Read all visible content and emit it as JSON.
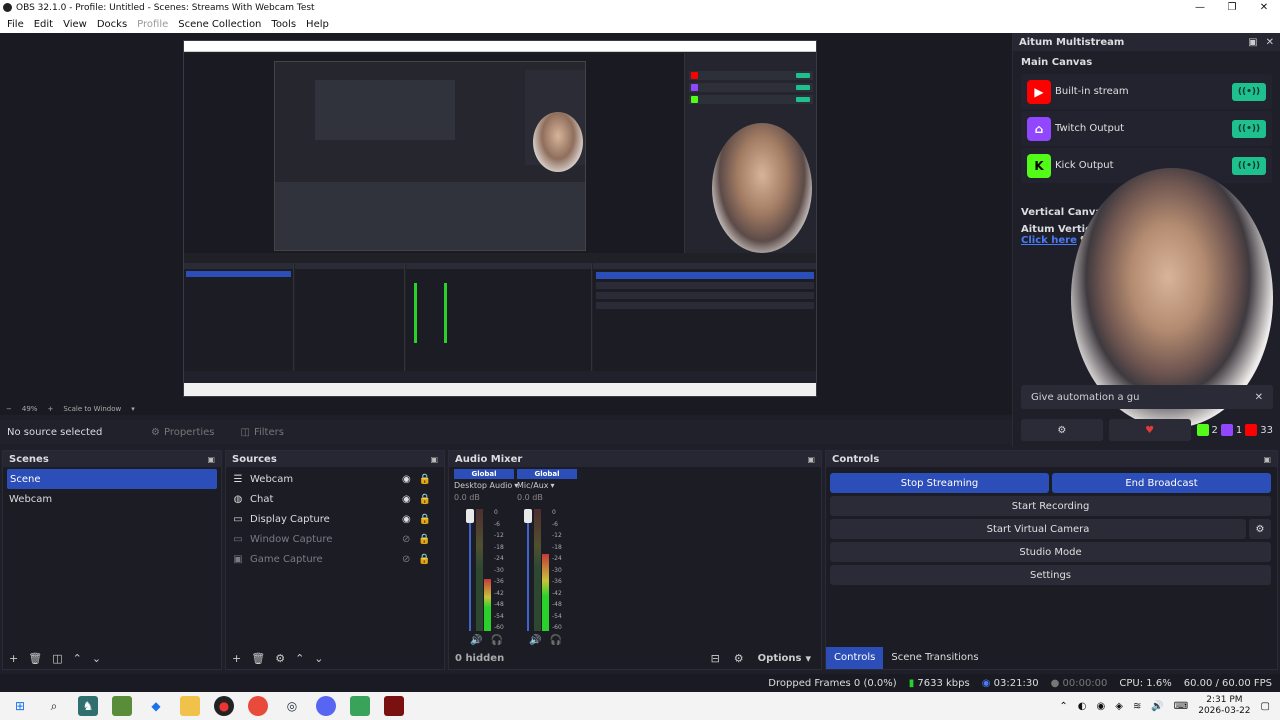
{
  "window": {
    "title": "OBS 32.1.0 - Profile: Untitled - Scenes: Streams With Webcam Test",
    "controls": [
      "—",
      "❐",
      "✕"
    ]
  },
  "menu": [
    {
      "label": "File",
      "enabled": true
    },
    {
      "label": "Edit",
      "enabled": true
    },
    {
      "label": "View",
      "enabled": true
    },
    {
      "label": "Docks",
      "enabled": true
    },
    {
      "label": "Profile",
      "enabled": false
    },
    {
      "label": "Scene Collection",
      "enabled": true
    },
    {
      "label": "Tools",
      "enabled": true
    },
    {
      "label": "Help",
      "enabled": true
    }
  ],
  "preview": {
    "zoom": "49%",
    "zoom_mode": "Scale to Window"
  },
  "source_toolbar": {
    "no_source": "No source selected",
    "properties": "Properties",
    "filters": "Filters"
  },
  "multistream": {
    "title": "Aitum Multistream",
    "main_canvas": "Main Canvas",
    "outputs": [
      {
        "name": "Built-in stream",
        "logo": "youtube-icon",
        "color": "#ff0000"
      },
      {
        "name": "Twitch Output",
        "logo": "twitch-icon",
        "color": "#9146ff"
      },
      {
        "name": "Kick Output",
        "logo": "kick-icon",
        "color": "#53fc18"
      }
    ],
    "toggle_glyph": "((•))",
    "vertical_canvas": "Vertical Canvas",
    "vertical_text": "Aitum Vertical i",
    "click_here": "Click here",
    "click_here_suffix": " to d",
    "automation_text": "Give automation a gu",
    "automation_close": "✕",
    "stats": {
      "kick": "2",
      "twitch": "1",
      "youtube": "33"
    }
  },
  "scenes": {
    "title": "Scenes",
    "items": [
      "Scene",
      "Webcam"
    ],
    "selected": 0
  },
  "sources": {
    "title": "Sources",
    "items": [
      {
        "name": "Webcam",
        "icon": "list-icon",
        "glyph": "☰",
        "visible": true
      },
      {
        "name": "Chat",
        "icon": "globe-icon",
        "glyph": "◍",
        "visible": true
      },
      {
        "name": "Display Capture",
        "icon": "monitor-icon",
        "glyph": "▭",
        "visible": true
      },
      {
        "name": "Window Capture",
        "icon": "window-icon",
        "glyph": "▭",
        "visible": false
      },
      {
        "name": "Game Capture",
        "icon": "gamepad-icon",
        "glyph": "▣",
        "visible": false
      }
    ]
  },
  "mixer": {
    "title": "Audio Mixer",
    "channels": [
      {
        "global": "Global",
        "name": "Desktop Audio",
        "db": "0.0 dB"
      },
      {
        "global": "Global",
        "name": "Mic/Aux",
        "db": "0.0 dB"
      }
    ],
    "ticks": [
      "0",
      "-6",
      "-12",
      "-18",
      "-24",
      "-30",
      "-36",
      "-42",
      "-48",
      "-54",
      "-60"
    ],
    "hidden": "0 hidden",
    "options": "Options"
  },
  "controls": {
    "title": "Controls",
    "stop_streaming": "Stop Streaming",
    "end_broadcast": "End Broadcast",
    "start_recording": "Start Recording",
    "start_virtual_camera": "Start Virtual Camera",
    "studio_mode": "Studio Mode",
    "settings": "Settings",
    "tab_controls": "Controls",
    "tab_scene_transitions": "Scene Transitions"
  },
  "status": {
    "dropped_frames": "Dropped Frames 0 (0.0%)",
    "bitrate": "7633 kbps",
    "stream_time": "03:21:30",
    "rec_time": "00:00:00",
    "cpu": "CPU: 1.6%",
    "fps": "60.00 / 60.00 FPS"
  },
  "taskbar": {
    "time": "2:31 PM",
    "date": "2026-03-22"
  },
  "colors": {
    "accent": "#2c4eb8",
    "toggle_on": "#1ec08e",
    "panel": "#1b1c24"
  }
}
